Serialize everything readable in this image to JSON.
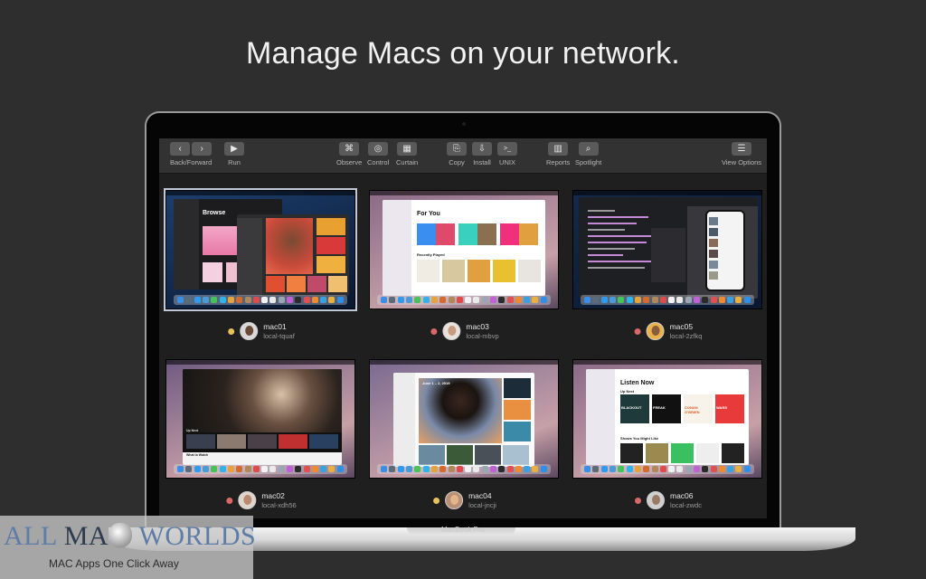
{
  "headline": "Manage Macs on your network.",
  "device_label": "MacBook Pro",
  "toolbar": {
    "groups": [
      {
        "id": "back-forward",
        "label": "Back/Forward",
        "buttons": [
          {
            "icon": "chevron-left-icon",
            "glyph": "‹"
          },
          {
            "icon": "chevron-right-icon",
            "glyph": "›"
          }
        ]
      },
      {
        "id": "run",
        "label": "Run",
        "buttons": [
          {
            "icon": "play-icon",
            "glyph": "▶"
          }
        ]
      },
      {
        "id": "observe",
        "label": "Observe",
        "buttons": [
          {
            "icon": "binoculars-icon",
            "glyph": "⌘"
          }
        ]
      },
      {
        "id": "control",
        "label": "Control",
        "buttons": [
          {
            "icon": "pointer-control-icon",
            "glyph": "◎"
          }
        ]
      },
      {
        "id": "curtain",
        "label": "Curtain",
        "buttons": [
          {
            "icon": "curtain-icon",
            "glyph": "▦"
          }
        ]
      },
      {
        "id": "copy",
        "label": "Copy",
        "buttons": [
          {
            "icon": "copy-file-icon",
            "glyph": "⎘"
          }
        ]
      },
      {
        "id": "install",
        "label": "Install",
        "buttons": [
          {
            "icon": "install-icon",
            "glyph": "⇩"
          }
        ]
      },
      {
        "id": "unix",
        "label": "UNIX",
        "buttons": [
          {
            "icon": "terminal-icon",
            "glyph": ">_"
          }
        ]
      },
      {
        "id": "reports",
        "label": "Reports",
        "buttons": [
          {
            "icon": "reports-icon",
            "glyph": "▥"
          }
        ]
      },
      {
        "id": "spotlight",
        "label": "Spotlight",
        "buttons": [
          {
            "icon": "search-icon",
            "glyph": "⌕"
          }
        ]
      },
      {
        "id": "view-options",
        "label": "View Options",
        "buttons": [
          {
            "icon": "list-icon",
            "glyph": "☰"
          }
        ]
      }
    ]
  },
  "computers": [
    {
      "name": "mac01",
      "host": "local-tquaf",
      "status_color": "#e8c15a",
      "avatar_bg": "#d9d9d9",
      "face": "#6b4a3a",
      "selected": true,
      "theme": "dark-music",
      "wall": "#1d3f6e"
    },
    {
      "name": "mac03",
      "host": "local-mbvp",
      "status_color": "#d9686b",
      "avatar_bg": "#e9e2dc",
      "face": "#c89a80",
      "selected": false,
      "theme": "light-music",
      "wall": "#8a6a88"
    },
    {
      "name": "mac05",
      "host": "local-2zfkq",
      "status_color": "#d9686b",
      "avatar_bg": "#e9b34a",
      "face": "#8c5a3c",
      "selected": false,
      "theme": "xcode",
      "wall": "#142a4a"
    },
    {
      "name": "mac02",
      "host": "local-xdh56",
      "status_color": "#d9686b",
      "avatar_bg": "#ded5cc",
      "face": "#b98a70",
      "selected": false,
      "theme": "tv",
      "wall": "#6e5a80"
    },
    {
      "name": "mac04",
      "host": "local-jncji",
      "status_color": "#e8c15a",
      "avatar_bg": "#b99075",
      "face": "#e2b58c",
      "selected": false,
      "theme": "photos",
      "wall": "#7a6a90"
    },
    {
      "name": "mac06",
      "host": "local-zwdc",
      "status_color": "#d9686b",
      "avatar_bg": "#cfcfcf",
      "face": "#9a7a66",
      "selected": false,
      "theme": "podcasts",
      "wall": "#8a6a88"
    }
  ],
  "thumbnails": {
    "dark-music": {
      "section_title": "Browse"
    },
    "light-music": {
      "section_title": "For You",
      "subsection": "Recently Played"
    },
    "xcode": {},
    "tv": {
      "subsection": "Up Next",
      "subsection2": "What to Watch"
    },
    "photos": {
      "date_range": "June 1 – 2, 2019"
    },
    "podcasts": {
      "section_title": "Listen Now",
      "subsection": "Up Next",
      "subsection2": "Shows You Might Like",
      "tiles": [
        "BLACKOUT",
        "FREAK",
        "CONAN O'BRIEN",
        "WARS"
      ]
    }
  },
  "watermark": {
    "title_part1": "ALL ",
    "title_part2": "MA",
    "title_part3": " WORLDS",
    "subtitle": "MAC Apps One Click Away"
  }
}
